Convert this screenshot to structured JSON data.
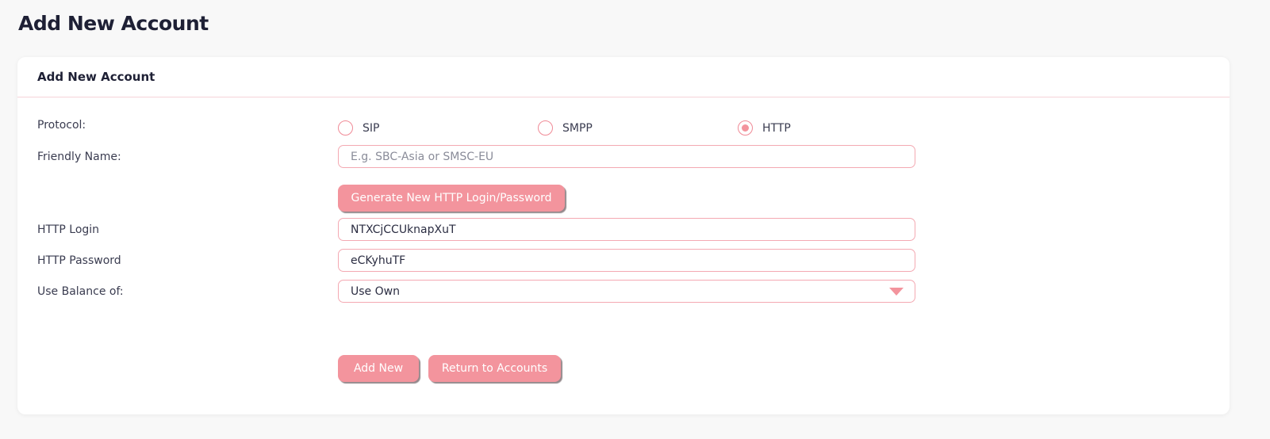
{
  "page": {
    "title": "Add New Account"
  },
  "card": {
    "header": "Add New Account"
  },
  "form": {
    "protocol": {
      "label": "Protocol:",
      "options": [
        "SIP",
        "SMPP",
        "HTTP"
      ],
      "selected": "HTTP"
    },
    "friendly_name": {
      "label": "Friendly Name:",
      "value": "",
      "placeholder": "E.g. SBC-Asia or SMSC-EU"
    },
    "generate_button": "Generate New HTTP Login/Password",
    "http_login": {
      "label": "HTTP Login",
      "value": "NTXCjCCUknapXuT"
    },
    "http_password": {
      "label": "HTTP Password",
      "value": "eCKyhuTF"
    },
    "use_balance": {
      "label": "Use Balance of:",
      "value": "Use Own"
    }
  },
  "actions": {
    "add_new": "Add New",
    "return": "Return to Accounts"
  },
  "colors": {
    "accent": "#f3949d",
    "border": "#f4a9b2",
    "title": "#1e2035"
  },
  "icons": {
    "select_caret": "chevron-down-icon"
  }
}
